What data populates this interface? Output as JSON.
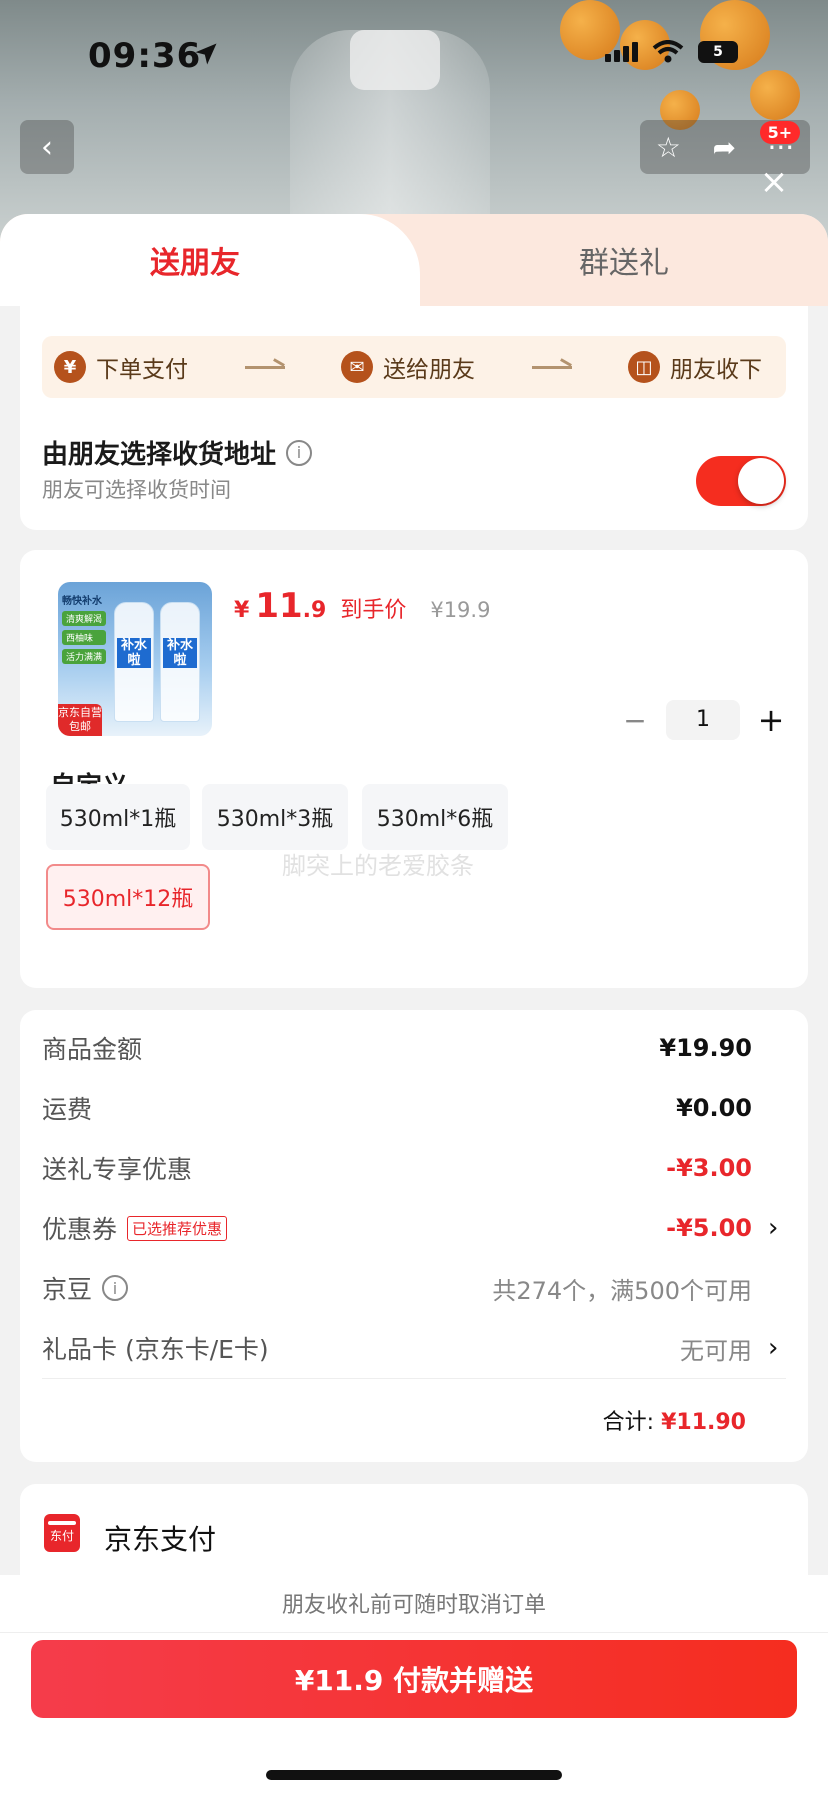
{
  "status_bar": {
    "time": "09:36",
    "battery": "5"
  },
  "nav": {
    "badge": "5+"
  },
  "tabs": [
    {
      "label": "送朋友",
      "active": true
    },
    {
      "label": "群送礼",
      "active": false
    }
  ],
  "flow": {
    "steps": [
      {
        "label": "下单支付",
        "icon": "yen-icon",
        "glyph": "¥"
      },
      {
        "label": "送给朋友",
        "icon": "wechat-icon",
        "glyph": "✉"
      },
      {
        "label": "朋友收下",
        "icon": "gift-icon",
        "glyph": "◫"
      }
    ]
  },
  "address": {
    "title": "由朋友选择收货地址",
    "info_glyph": "i",
    "subtitle": "朋友可选择收货时间",
    "toggle_on": true
  },
  "product": {
    "image_text": {
      "tags": [
        "畅快补水",
        "清爽解渴",
        "西柚味",
        "活力满满"
      ],
      "bottle_label": "补水 啦",
      "ship_badge": "京东自营 包邮"
    },
    "price_symbol": "¥",
    "price_int": "11",
    "price_dec": ".9",
    "price_tag": "到手价",
    "orig_price": "¥19.9",
    "quantity": "1",
    "minus": "−",
    "plus": "+",
    "spec_title": "自定义",
    "specs": [
      "530ml*1瓶",
      "530ml*3瓶",
      "530ml*6瓶",
      "530ml*12瓶"
    ],
    "selected_spec": "530ml*12瓶",
    "watermark": "脚突上的老爱胶条"
  },
  "summary": {
    "rows": [
      {
        "label": "商品金额",
        "value": "¥19.90"
      },
      {
        "label": "运费",
        "value": "¥0.00"
      },
      {
        "label": "送礼专享优惠",
        "value": "-¥3.00"
      },
      {
        "label": "优惠券",
        "tag": "已选推荐优惠",
        "value": "-¥5.00"
      },
      {
        "label": "京豆",
        "value": "共274个，满500个可用"
      },
      {
        "label": "礼品卡 (京东卡/E卡)",
        "value": "无可用"
      }
    ],
    "total_label": "合计:",
    "total_value": "¥11.90"
  },
  "payment": {
    "icon_text": "东付",
    "label": "京东支付"
  },
  "footer": {
    "note": "朋友收礼前可随时取消订单",
    "button": "¥11.9 付款并赠送"
  },
  "colors": {
    "accent": "#e8262b",
    "toggle": "#f52d1f",
    "tab_bg": "#fce8de"
  }
}
